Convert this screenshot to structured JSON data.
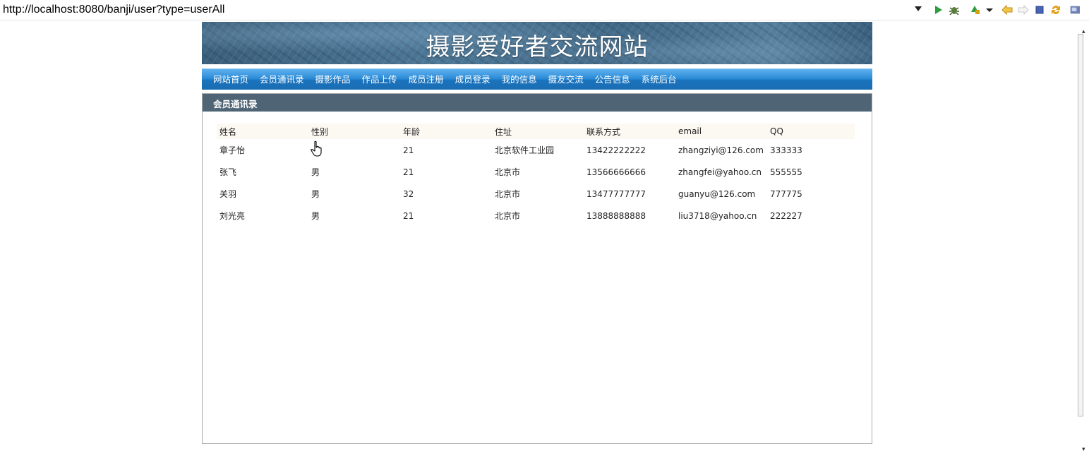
{
  "browser": {
    "url": "http://localhost:8080/banji/user?type=userAll",
    "buttons": [
      "run-icon",
      "debug-icon",
      "external-tools-icon",
      "back-icon",
      "forward-icon",
      "stop-icon",
      "refresh-icon"
    ]
  },
  "site": {
    "title": "摄影爱好者交流网站"
  },
  "nav": {
    "items": [
      {
        "label": "网站首页"
      },
      {
        "label": "会员通讯录"
      },
      {
        "label": "摄影作品"
      },
      {
        "label": "作品上传"
      },
      {
        "label": "成员注册"
      },
      {
        "label": "成员登录"
      },
      {
        "label": "我的信息"
      },
      {
        "label": "摄友交流"
      },
      {
        "label": "公告信息"
      },
      {
        "label": "系统后台"
      }
    ]
  },
  "panel": {
    "title": "会员通讯录",
    "columns": [
      "姓名",
      "性别",
      "年龄",
      "住址",
      "联系方式",
      "email",
      "QQ"
    ],
    "rows": [
      [
        "章子怡",
        "",
        "21",
        "北京软件工业园",
        "13422222222",
        "zhangziyi@126.com",
        "333333"
      ],
      [
        "张飞",
        "男",
        "21",
        "北京市",
        "13566666666",
        "zhangfei@yahoo.cn",
        "555555"
      ],
      [
        "关羽",
        "男",
        "32",
        "北京市",
        "13477777777",
        "guanyu@126.com",
        "777775"
      ],
      [
        "刘光亮",
        "男",
        "21",
        "北京市",
        "13888888888",
        "liu3718@yahoo.cn",
        "222227"
      ]
    ]
  }
}
